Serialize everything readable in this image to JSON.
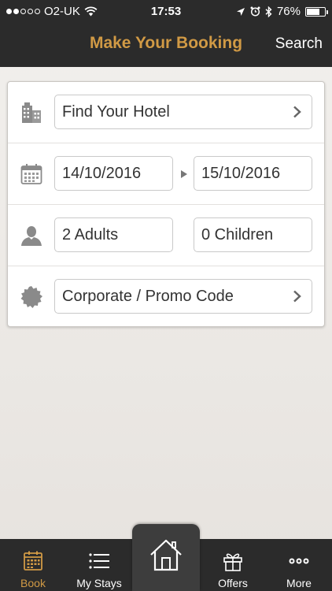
{
  "status_bar": {
    "carrier": "O2-UK",
    "time": "17:53",
    "battery": "76%",
    "battery_level": 0.76
  },
  "nav": {
    "title": "Make Your Booking",
    "search_label": "Search"
  },
  "booking": {
    "hotel_field": "Find Your Hotel",
    "check_in": "14/10/2016",
    "check_out": "15/10/2016",
    "adults": "2 Adults",
    "children": "0 Children",
    "promo_field": "Corporate / Promo Code"
  },
  "icons": {
    "hotel": "building-icon",
    "dates": "calendar-icon",
    "guests": "person-icon",
    "promo": "badge-icon"
  },
  "tabs": [
    {
      "label": "Book",
      "icon": "calendar-icon",
      "active": true
    },
    {
      "label": "My Stays",
      "icon": "list-icon",
      "active": false
    },
    {
      "label": "",
      "icon": "home-icon",
      "active": false
    },
    {
      "label": "Offers",
      "icon": "gift-icon",
      "active": false
    },
    {
      "label": "More",
      "icon": "more-dots-icon",
      "active": false
    }
  ],
  "colors": {
    "accent": "#d19a45",
    "bar_background": "#2b2b2b",
    "icon_gray": "#8a8a8a"
  }
}
